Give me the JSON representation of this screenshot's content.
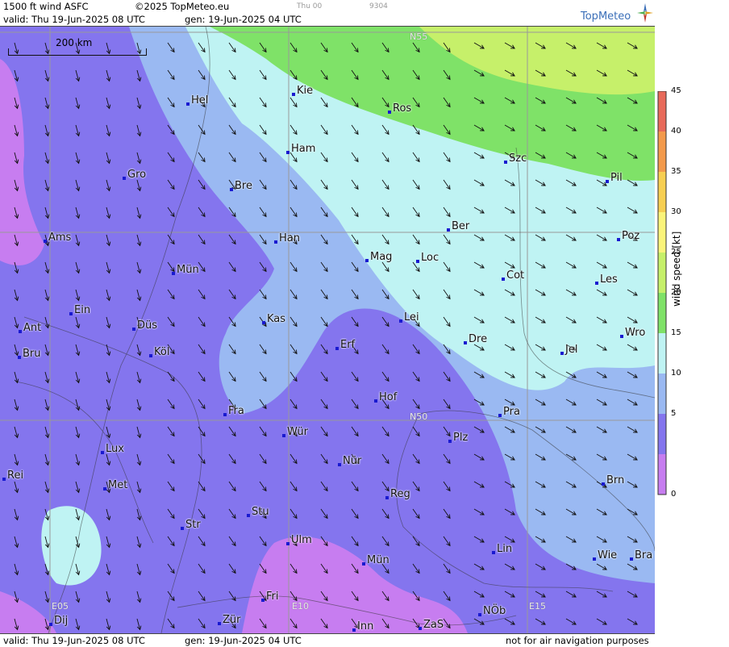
{
  "header": {
    "product": "1500 ft wind ASFC",
    "copyright": "©2025 TopMeteo.eu",
    "run_label": "Thu 00",
    "run_code": "9304",
    "valid": "valid:  Thu  19-Jun-2025  08 UTC",
    "generated": "gen: 19-Jun-2025 04 UTC",
    "brand": "TopMeteo"
  },
  "footer": {
    "valid": "valid:  Thu  19-Jun-2025  08 UTC",
    "generated": "gen: 19-Jun-2025 04 UTC",
    "disclaimer": "not for air navigation purposes"
  },
  "scale_bar": "200 km",
  "grid_labels": [
    "N55",
    "N50",
    "E05",
    "E10",
    "E15"
  ],
  "cities": [
    "Hel",
    "Kie",
    "Ros",
    "Ham",
    "Szc",
    "Pil",
    "Gro",
    "Bre",
    "Ber",
    "Poz",
    "Ams",
    "Han",
    "Mag",
    "Loc",
    "Cot",
    "Les",
    "Mün",
    "Ein",
    "Kas",
    "Lei",
    "Wro",
    "Ant",
    "Düs",
    "Dre",
    "Bru",
    "Köl",
    "Erf",
    "Jel",
    "Hof",
    "Pra",
    "Fra",
    "Lux",
    "Wür",
    "Plz",
    "Rei",
    "Nür",
    "Met",
    "Brn",
    "Reg",
    "Stu",
    "Str",
    "Lin",
    "Ulm",
    "Wie",
    "Bra",
    "Mün",
    "Fri",
    "NÖb",
    "Dij",
    "Zür",
    "ZaS",
    "Inn"
  ],
  "legend": {
    "unit": "wind speed [kt]",
    "ticks": [
      "45",
      "40",
      "35",
      "30",
      "25",
      "20",
      "15",
      "10",
      "5",
      "0"
    ],
    "colors": [
      "#e86a5a",
      "#f39a4c",
      "#f7cf52",
      "#fbf47a",
      "#c6f06a",
      "#7fe268",
      "#bff3f3",
      "#9ab9f2",
      "#8475ee",
      "#c77df0"
    ]
  },
  "colors": {
    "band_0_5": "#c77df0",
    "band_5_10": "#8475ee",
    "band_10_15": "#9ab9f2",
    "band_15_20": "#bff3f3",
    "band_20_25": "#7fe268",
    "band_25_30": "#c6f06a"
  }
}
